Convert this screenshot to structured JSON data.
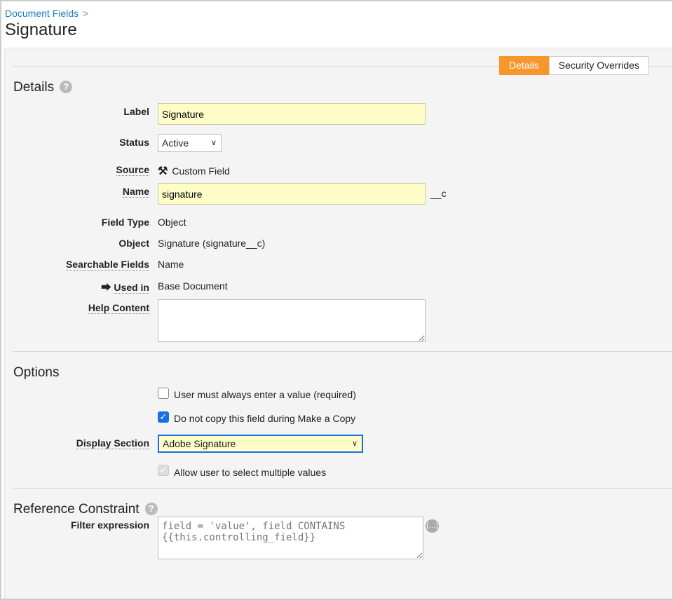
{
  "breadcrumb": {
    "parent": "Document Fields",
    "separator": ">"
  },
  "page_title": "Signature",
  "tabs": [
    {
      "label": "Details",
      "active": true
    },
    {
      "label": "Security Overrides",
      "active": false
    }
  ],
  "details": {
    "heading": "Details",
    "label": {
      "label": "Label",
      "value": "Signature"
    },
    "status": {
      "label": "Status",
      "value": "Active"
    },
    "source": {
      "label": "Source",
      "value": "Custom Field",
      "icon": "hammer-icon"
    },
    "name": {
      "label": "Name",
      "value": "signature",
      "suffix": "__c"
    },
    "field_type": {
      "label": "Field Type",
      "value": "Object"
    },
    "object": {
      "label": "Object",
      "value": "Signature (signature__c)"
    },
    "searchable_fields": {
      "label": "Searchable Fields",
      "value": "Name"
    },
    "used_in": {
      "label": "Used in",
      "value": "Base Document",
      "icon": "share-icon"
    },
    "help_content": {
      "label": "Help Content",
      "value": ""
    }
  },
  "options": {
    "heading": "Options",
    "required": {
      "label": "User must always enter a value (required)",
      "checked": false
    },
    "no_copy": {
      "label": "Do not copy this field during Make a Copy",
      "checked": true
    },
    "display_section": {
      "label": "Display Section",
      "value": "Adobe Signature"
    },
    "multiple": {
      "label": "Allow user to select multiple values",
      "checked": true,
      "disabled": true
    }
  },
  "reference": {
    "heading": "Reference Constraint",
    "filter": {
      "label": "Filter expression",
      "placeholder": "field = 'value', field CONTAINS {{this.controlling_field}}"
    }
  },
  "colors": {
    "accent": "#f7962a",
    "link": "#1a7bc4",
    "input_bg": "#fefdc8",
    "focus": "#1a6fe0"
  }
}
